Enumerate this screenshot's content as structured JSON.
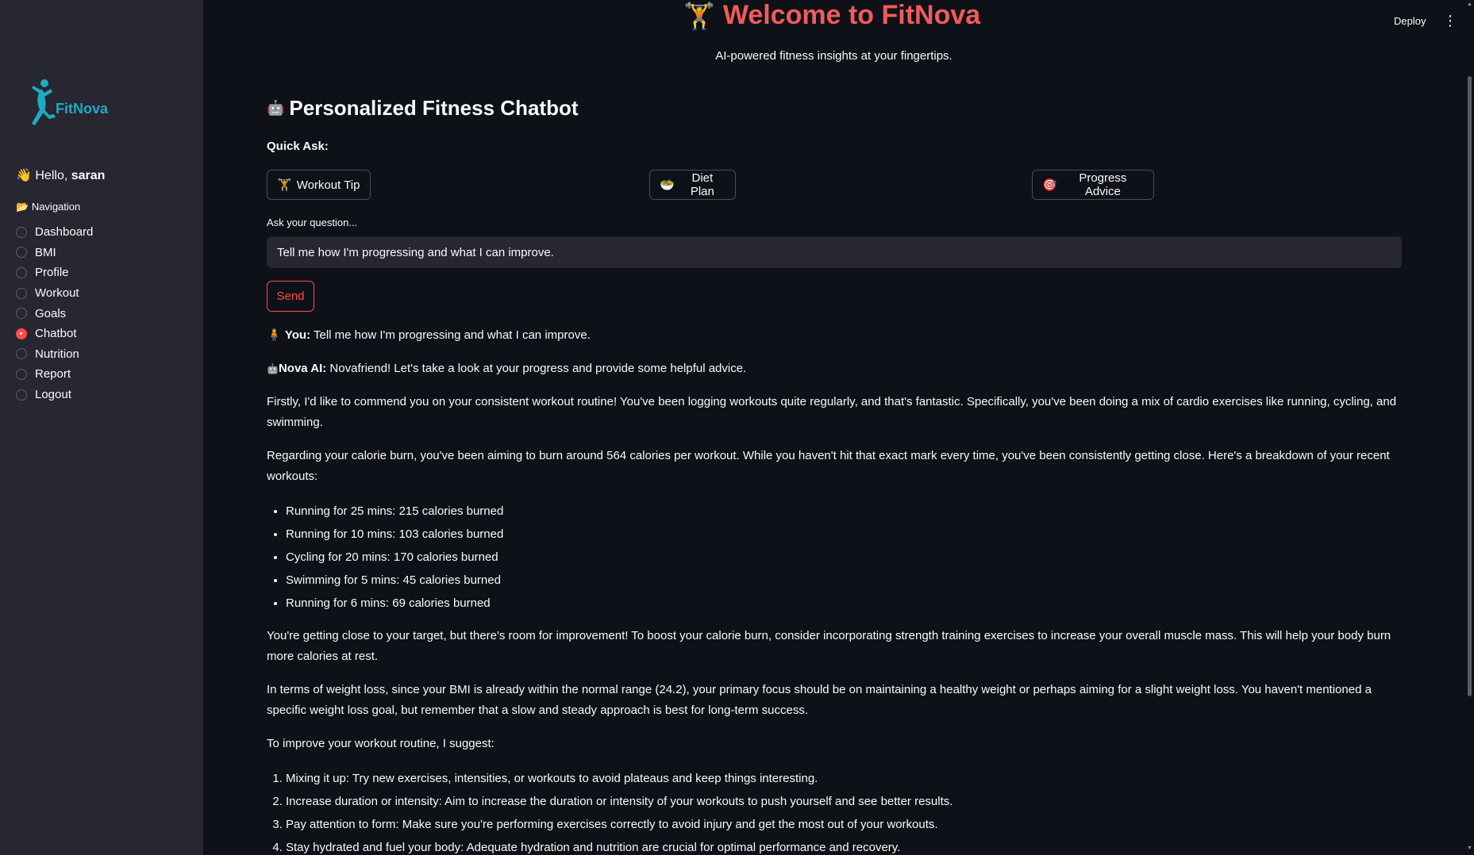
{
  "sidebar": {
    "logo_text": "FitNova",
    "greeting_emoji": "👋",
    "greeting_prefix": "Hello, ",
    "greeting_user": "saran",
    "nav_emoji": "📂",
    "nav_heading": "Navigation",
    "items": [
      {
        "label": "Dashboard",
        "selected": false
      },
      {
        "label": "BMI",
        "selected": false
      },
      {
        "label": "Profile",
        "selected": false
      },
      {
        "label": "Workout",
        "selected": false
      },
      {
        "label": "Goals",
        "selected": false
      },
      {
        "label": "Chatbot",
        "selected": true
      },
      {
        "label": "Nutrition",
        "selected": false
      },
      {
        "label": "Report",
        "selected": false
      },
      {
        "label": "Logout",
        "selected": false
      }
    ]
  },
  "header": {
    "title_icon": "🏋",
    "title": "Welcome to FitNova",
    "subtitle": "AI-powered fitness insights at your fingertips.",
    "deploy_label": "Deploy",
    "menu_icon": "⋮"
  },
  "main": {
    "section_icon": "🤖",
    "section_title": "Personalized Fitness Chatbot",
    "quick_ask_label": "Quick Ask:",
    "quick_buttons": [
      {
        "icon": "🏋",
        "label": "Workout Tip"
      },
      {
        "icon": "🥗",
        "label": "Diet Plan"
      },
      {
        "icon": "🎯",
        "label": "Progress Advice"
      }
    ],
    "ask_label": "Ask your question...",
    "ask_value": "Tell me how I'm progressing and what I can improve.",
    "send_label": "Send"
  },
  "chat": {
    "you_icon": "🧍",
    "you_label": "You:",
    "you_text": "Tell me how I'm progressing and what I can improve.",
    "ai_icon": "🤖",
    "ai_label": "Nova AI:",
    "ai_intro": "Novafriend! Let's take a look at your progress and provide some helpful advice.",
    "p1": "Firstly, I'd like to commend you on your consistent workout routine! You've been logging workouts quite regularly, and that's fantastic. Specifically, you've been doing a mix of cardio exercises like running, cycling, and swimming.",
    "p2": "Regarding your calorie burn, you've been aiming to burn around 564 calories per workout. While you haven't hit that exact mark every time, you've been consistently getting close. Here's a breakdown of your recent workouts:",
    "workouts": [
      "Running for 25 mins: 215 calories burned",
      "Running for 10 mins: 103 calories burned",
      "Cycling for 20 mins: 170 calories burned",
      "Swimming for 5 mins: 45 calories burned",
      "Running for 6 mins: 69 calories burned"
    ],
    "p3": "You're getting close to your target, but there's room for improvement! To boost your calorie burn, consider incorporating strength training exercises to increase your overall muscle mass. This will help your body burn more calories at rest.",
    "p4": "In terms of weight loss, since your BMI is already within the normal range (24.2), your primary focus should be on maintaining a healthy weight or perhaps aiming for a slight weight loss. You haven't mentioned a specific weight loss goal, but remember that a slow and steady approach is best for long-term success.",
    "p5": "To improve your workout routine, I suggest:",
    "suggestions": [
      "Mixing it up: Try new exercises, intensities, or workouts to avoid plateaus and keep things interesting.",
      "Increase duration or intensity: Aim to increase the duration or intensity of your workouts to push yourself and see better results.",
      "Pay attention to form: Make sure you're performing exercises correctly to avoid injury and get the most out of your workouts.",
      "Stay hydrated and fuel your body: Adequate hydration and nutrition are crucial for optimal performance and recovery."
    ]
  },
  "colors": {
    "accent": "#ff4b4b",
    "title": "#f05b5b",
    "logo": "#1fa9c4",
    "sidebar_bg": "#262730",
    "page_bg": "#0e1117"
  }
}
